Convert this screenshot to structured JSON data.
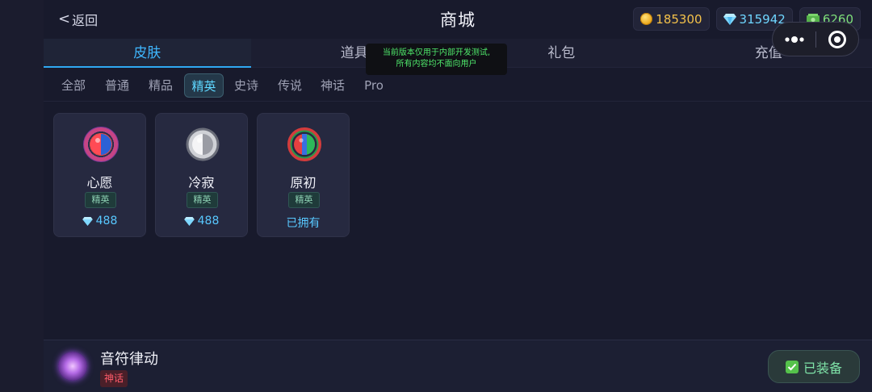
{
  "header": {
    "back_label": "返回",
    "back_icon": "chevron-left-icon",
    "title": "商城",
    "currencies": [
      {
        "icon": "gold-coin-icon",
        "value": "185300",
        "color": "#f3c14a"
      },
      {
        "icon": "diamond-icon",
        "value": "315942",
        "color": "#6fd6ff"
      },
      {
        "icon": "cash-icon",
        "value": "6260",
        "color": "#7fe07a"
      }
    ]
  },
  "capsule": {
    "more_icon": "more-dots-icon",
    "close_icon": "target-close-icon"
  },
  "tabs": [
    {
      "label": "皮肤",
      "active": true
    },
    {
      "label": "道具",
      "active": false
    },
    {
      "label": "礼包",
      "active": false
    },
    {
      "label": "充值",
      "active": false
    }
  ],
  "notice": {
    "line1": "当前版本仅用于内部开发测试,",
    "line2": "所有内容均不面向用户"
  },
  "subtabs": [
    {
      "label": "全部"
    },
    {
      "label": "普通"
    },
    {
      "label": "精品"
    },
    {
      "label": "精英",
      "active": true
    },
    {
      "label": "史诗"
    },
    {
      "label": "传说"
    },
    {
      "label": "神话"
    },
    {
      "label": "Pro"
    }
  ],
  "items": [
    {
      "name": "心愿",
      "tier": "精英",
      "price": "488",
      "owned": false
    },
    {
      "name": "冷寂",
      "tier": "精英",
      "price": "488",
      "owned": false
    },
    {
      "name": "原初",
      "tier": "精英",
      "owned_label": "已拥有",
      "owned": true
    }
  ],
  "equipped": {
    "name": "音符律动",
    "tier": "神话",
    "button_label": "已装备"
  },
  "colors": {
    "accent": "#3fb7ff",
    "background": "#181a2c",
    "mythic_red": "#ff5b6a"
  }
}
